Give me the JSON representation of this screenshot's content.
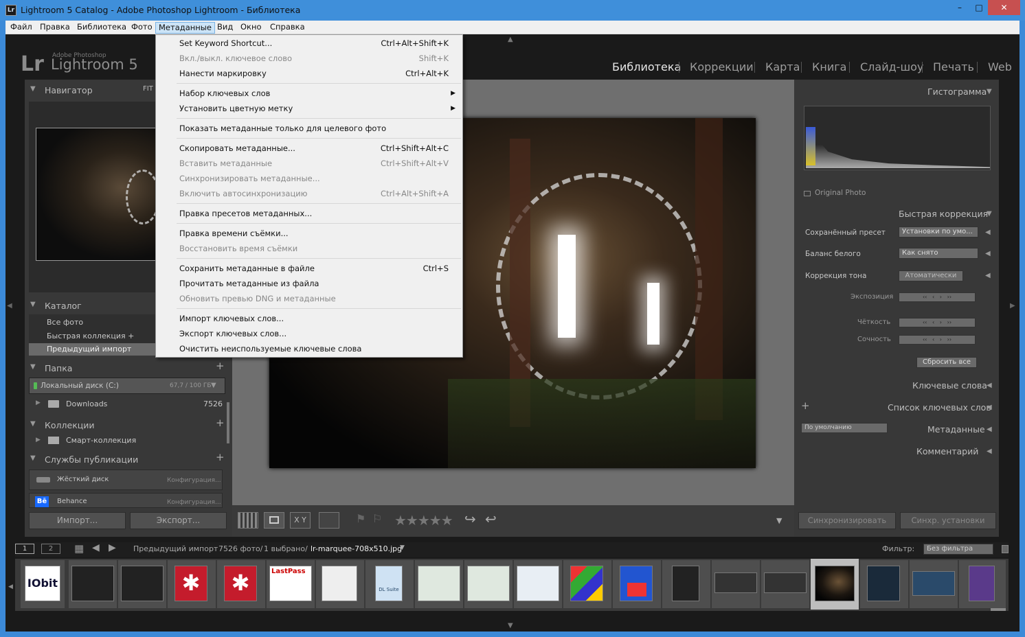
{
  "window": {
    "title": "Lightroom 5 Catalog - Adobe Photoshop Lightroom - Библиотека",
    "icon_text": "Lr",
    "minimize": "–",
    "maximize": "□",
    "close": "✕"
  },
  "menubar": [
    "Файл",
    "Правка",
    "Библиотека",
    "Фото",
    "Метаданные",
    "Вид",
    "Окно",
    "Справка"
  ],
  "brand": {
    "logo": "Lr",
    "small": "Adobe Photoshop",
    "name": "Lightroom 5"
  },
  "modules": [
    "Библиотека",
    "Коррекции",
    "Карта",
    "Книга",
    "Слайд-шоу",
    "Печать",
    "Web"
  ],
  "left": {
    "navigator": {
      "title": "Навигатор",
      "fit": "FIT"
    },
    "catalog": {
      "title": "Каталог",
      "items": [
        "Все фото",
        "Быстрая коллекция +",
        "Предыдущий импорт"
      ]
    },
    "folders": {
      "title": "Папка",
      "disk": "Локальный диск (C:)",
      "disk_size": "67,7 / 100 ГБ",
      "folder": "Downloads",
      "folder_count": "7526"
    },
    "collections": {
      "title": "Коллекции",
      "item": "Смарт-коллекция"
    },
    "publish": {
      "title": "Службы публикации",
      "hd": "Жёсткий диск",
      "hd_cfg": "Конфигурация...",
      "be": "Behance",
      "be_cfg": "Конфигурация...",
      "be_icon": "Bē"
    },
    "import_btn": "Импорт...",
    "export_btn": "Экспорт..."
  },
  "menu": {
    "items": [
      {
        "label": "Set Keyword Shortcut...",
        "shortcut": "Ctrl+Alt+Shift+K",
        "disabled": false
      },
      {
        "label": "Вкл./выкл. ключевое слово",
        "shortcut": "Shift+K",
        "disabled": true
      },
      {
        "label": "Нанести маркировку",
        "shortcut": "Ctrl+Alt+K",
        "disabled": false
      },
      {
        "label": "Набор ключевых слов",
        "shortcut": "",
        "disabled": false,
        "submenu": true
      },
      {
        "label": "Установить цветную метку",
        "shortcut": "",
        "disabled": false,
        "submenu": true
      },
      {
        "label": "Показать метаданные только для целевого фото",
        "shortcut": "",
        "disabled": false
      },
      {
        "label": "Скопировать метаданные...",
        "shortcut": "Ctrl+Shift+Alt+C",
        "disabled": false
      },
      {
        "label": "Вставить метаданные",
        "shortcut": "Ctrl+Shift+Alt+V",
        "disabled": true
      },
      {
        "label": "Синхронизировать метаданные...",
        "shortcut": "",
        "disabled": true
      },
      {
        "label": "Включить автосинхронизацию",
        "shortcut": "Ctrl+Alt+Shift+A",
        "disabled": true
      },
      {
        "label": "Правка пресетов метаданных...",
        "shortcut": "",
        "disabled": false
      },
      {
        "label": "Правка времени съёмки...",
        "shortcut": "",
        "disabled": false
      },
      {
        "label": "Восстановить время съёмки",
        "shortcut": "",
        "disabled": true
      },
      {
        "label": "Сохранить метаданные в файле",
        "shortcut": "Ctrl+S",
        "disabled": false
      },
      {
        "label": "Прочитать метаданные из файла",
        "shortcut": "",
        "disabled": false
      },
      {
        "label": "Обновить превью DNG и метаданные",
        "shortcut": "",
        "disabled": true
      },
      {
        "label": "Импорт ключевых слов...",
        "shortcut": "",
        "disabled": false
      },
      {
        "label": "Экспорт ключевых слов...",
        "shortcut": "",
        "disabled": false
      },
      {
        "label": "Очистить неиспользуемые ключевые слова",
        "shortcut": "",
        "disabled": false
      }
    ]
  },
  "right": {
    "histogram": "Гистограмма",
    "original_photo": "Original Photo",
    "quick": "Быстрая коррекция",
    "preset_label": "Сохранённый пресет",
    "preset_value": "Установки по умо...",
    "wb_label": "Баланс белого",
    "wb_value": "Как снято",
    "tone_label": "Коррекция тона",
    "tone_value": "Атоматически",
    "exposure": "Экспозиция",
    "clarity": "Чёткость",
    "vibrance": "Сочность",
    "reset": "Сбросить все",
    "keywords": "Ключевые слова",
    "keyword_list": "Список ключевых слов",
    "metadata": "Метаданные",
    "metadata_preset": "По умолчанию",
    "comments": "Комментарий",
    "sync": "Синхронизировать",
    "sync_settings": "Синхр. установки"
  },
  "toolbar": {
    "stars": "★★★★★",
    "view_icons": [
      "grid-icon",
      "loupe-icon",
      "compare-icon",
      "survey-icon"
    ]
  },
  "filmbar": {
    "page1": "1",
    "page2": "2",
    "source": "Предыдущий импорт",
    "info": "7526 фото/",
    "selected": "1 выбрано/",
    "file": "lr-marquee-708x510.jpg",
    "filter_label": "Фильтр:",
    "filter_value": "Без фильтра"
  },
  "thumbs": {
    "iobit": "IObit",
    "lastpass": "LastPass",
    "diskcard": "DL Suite"
  }
}
